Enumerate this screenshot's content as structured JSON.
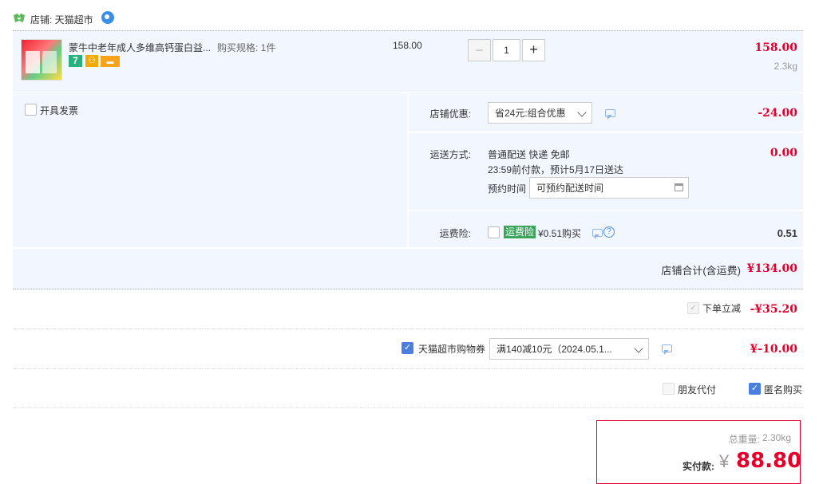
{
  "store": {
    "label": "店铺: 天猫超市"
  },
  "product": {
    "name": "蒙牛中老年成人多维高钙蛋白益...",
    "spec": "购买规格: 1件",
    "price": "158.00",
    "quantity": "1",
    "minus": "−",
    "plus": "+",
    "total": "158.00",
    "weight": "2.3kg",
    "badges": [
      "7",
      "⚇",
      "▬"
    ]
  },
  "invoice": {
    "label": "开具发票"
  },
  "shop_discount": {
    "label": "店铺优惠:",
    "select": "省24元:组合优惠",
    "amount": "-24.00"
  },
  "delivery": {
    "label": "运送方式:",
    "line1": "普通配送 快递 免邮",
    "line2": "23:59前付款，预计5月17日送达",
    "reserve_label": "预约时间",
    "reserve_placeholder": "可预约配送时间",
    "amount": "0.00"
  },
  "insurance": {
    "label": "运费险:",
    "tag": "运费险",
    "price": "¥0.51购买",
    "help": "?",
    "amount": "0.51"
  },
  "shop_total": {
    "label": "店铺合计(含运费)",
    "amount": "¥134.00"
  },
  "instant_discount": {
    "label": "下单立减",
    "amount": "-¥35.20"
  },
  "coupon": {
    "label": "天猫超市购物券",
    "select": "满140减10元（2024.05.1...",
    "amount": "¥-10.00"
  },
  "options": {
    "friend_pay": "朋友代付",
    "anonymous": "匿名购买"
  },
  "summary": {
    "weight_label": "总重量:",
    "weight": "2.30kg",
    "pay_label": "实付款:",
    "currency": "¥",
    "pay_amount": "88.80"
  },
  "colors": {
    "accent_red": "#e4002b",
    "panel_bg": "#f2f7ff",
    "tag_green": "#3aa55a",
    "checkbox_blue": "#4a7fe0"
  }
}
